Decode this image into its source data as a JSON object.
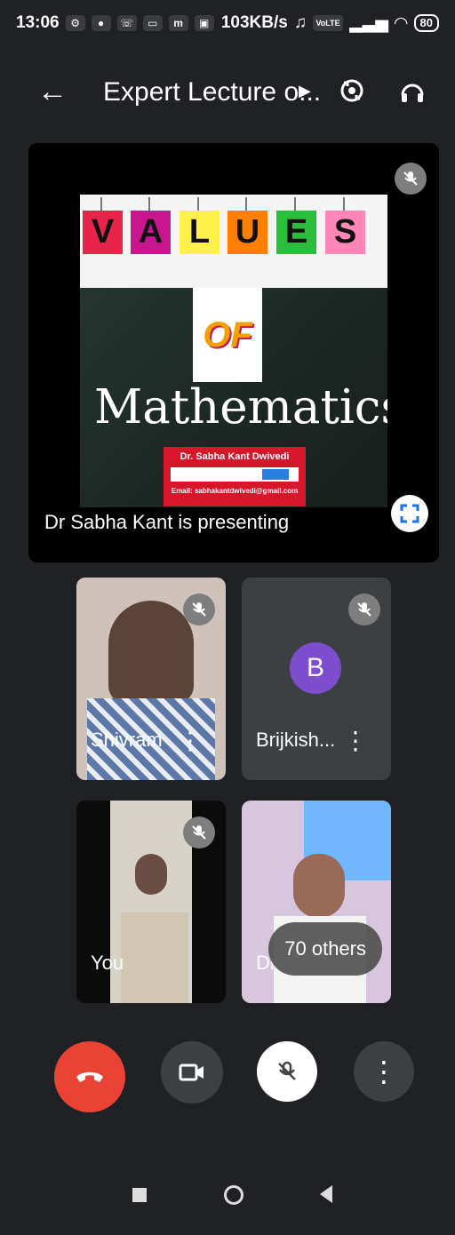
{
  "status": {
    "time": "13:06",
    "network_speed": "103KB/s",
    "battery": "80",
    "volte": "VoLTE"
  },
  "meeting": {
    "title": "Expert Lecture o..."
  },
  "presentation": {
    "slide_letters": [
      "V",
      "A",
      "L",
      "U",
      "E",
      "S"
    ],
    "of_text": "OF",
    "title_text": "Mathematics",
    "author": "Dr. Sabha Kant Dwivedi",
    "email": "Email: sabhakantdwivedi@gmail.com",
    "presenter_text": "Dr Sabha Kant is presenting"
  },
  "participants": [
    {
      "name": "Shivram"
    },
    {
      "name": "Brijkish...",
      "initial": "B"
    },
    {
      "name": "You"
    },
    {
      "name": "Dr"
    }
  ],
  "others_label": "70 others",
  "colors": {
    "background": "#202124",
    "end_call": "#ea4335",
    "avatar": "#7c4dcc",
    "slide_red": "#d7152b"
  }
}
